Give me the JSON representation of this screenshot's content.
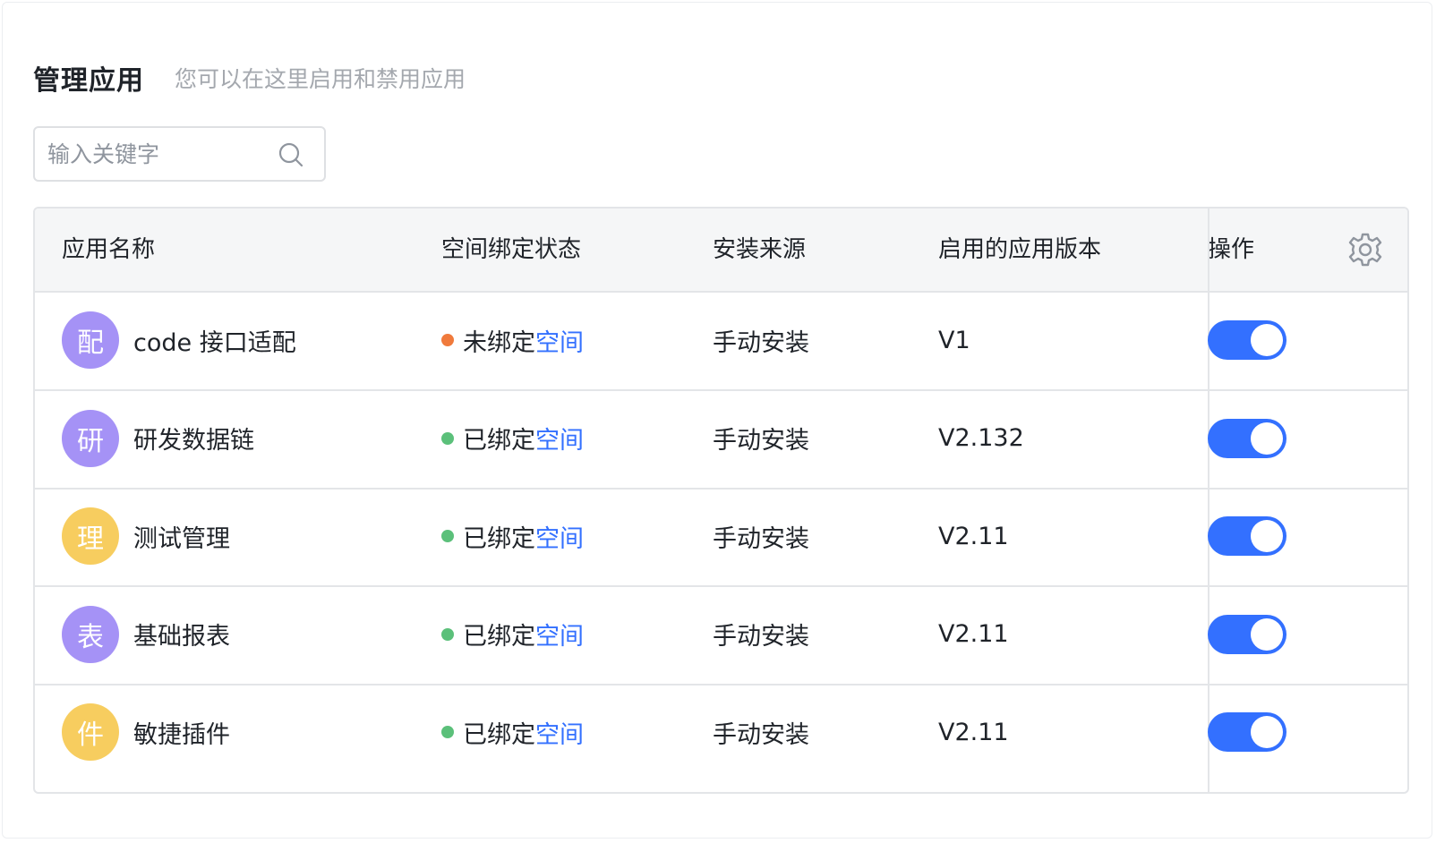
{
  "header": {
    "title": "管理应用",
    "subtitle": "您可以在这里启用和禁用应用"
  },
  "search": {
    "placeholder": "输入关键字",
    "value": ""
  },
  "table": {
    "columns": {
      "name": "应用名称",
      "bind_status": "空间绑定状态",
      "source": "安装来源",
      "version": "启用的应用版本",
      "action": "操作"
    },
    "rows": [
      {
        "avatar_char": "配",
        "avatar_color": "#a592f6",
        "name": "code 接口适配",
        "status_text": "未绑定",
        "status_link": "空间",
        "status_color": "#f07a3c",
        "source": "手动安装",
        "version": "V1",
        "enabled": true
      },
      {
        "avatar_char": "研",
        "avatar_color": "#a592f6",
        "name": "研发数据链",
        "status_text": "已绑定",
        "status_link": "空间",
        "status_color": "#5bc07a",
        "source": "手动安装",
        "version": "V2.132",
        "enabled": true
      },
      {
        "avatar_char": "理",
        "avatar_color": "#f7cd5f",
        "name": "测试管理",
        "status_text": "已绑定",
        "status_link": "空间",
        "status_color": "#5bc07a",
        "source": "手动安装",
        "version": "V2.11",
        "enabled": true
      },
      {
        "avatar_char": "表",
        "avatar_color": "#a592f6",
        "name": "基础报表",
        "status_text": "已绑定",
        "status_link": "空间",
        "status_color": "#5bc07a",
        "source": "手动安装",
        "version": "V2.11",
        "enabled": true
      },
      {
        "avatar_char": "件",
        "avatar_color": "#f7cd5f",
        "name": "敏捷插件",
        "status_text": "已绑定",
        "status_link": "空间",
        "status_color": "#5bc07a",
        "source": "手动安装",
        "version": "V2.11",
        "enabled": true
      }
    ]
  },
  "colors": {
    "accent": "#3370ff",
    "link": "#3370ff",
    "unbound": "#f07a3c",
    "bound": "#5bc07a"
  },
  "icons": {
    "search": "search-icon",
    "settings": "gear-icon"
  }
}
